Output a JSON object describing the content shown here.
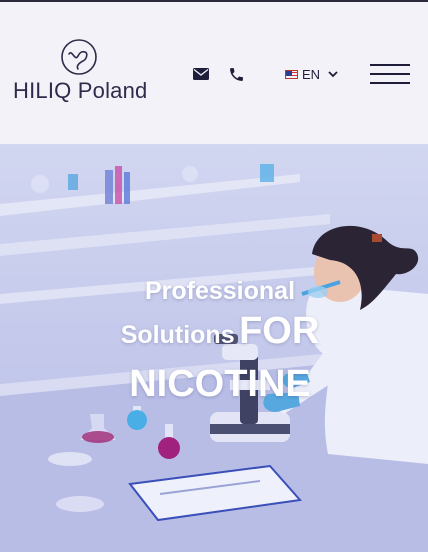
{
  "brand": {
    "name": "HILIQ Poland"
  },
  "header": {
    "icons": {
      "email": "envelope-icon",
      "phone": "phone-icon",
      "menu": "hamburger-menu-icon",
      "chevron": "chevron-down-icon"
    },
    "language": {
      "code": "EN",
      "flag": "us-flag-icon"
    }
  },
  "hero": {
    "line1": "Professional",
    "line2_small": "Solutions",
    "line2_big": "FOR",
    "line3": "NICOTINE"
  },
  "colors": {
    "brand_navy": "#2f2b4a",
    "header_bg": "#f3f2f8",
    "hero_tint": "#aeb4e2",
    "glove_blue": "#58a8e0"
  }
}
